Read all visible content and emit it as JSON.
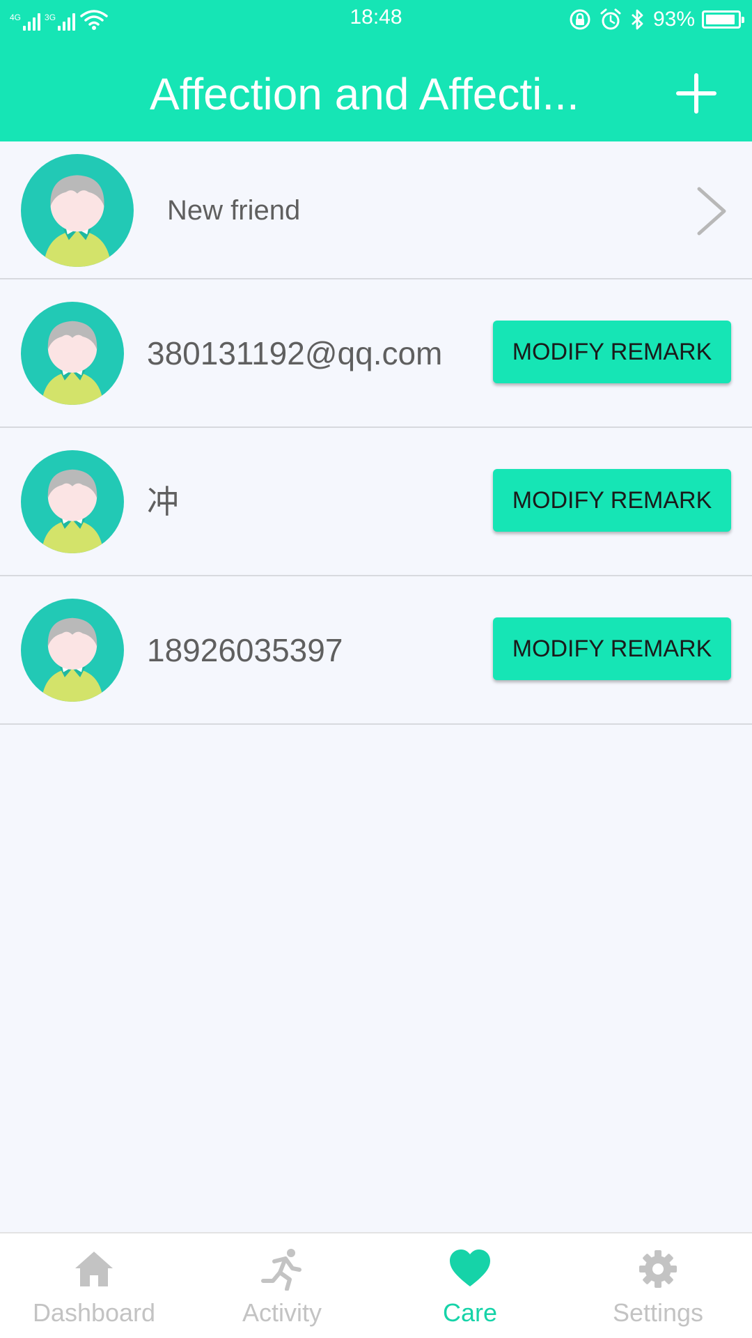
{
  "status_bar": {
    "network_1": "4G",
    "network_2": "3G",
    "time": "18:48",
    "battery": "93%",
    "battery_level": 0.93
  },
  "header": {
    "title": "Affection and Affecti...",
    "add_icon": "plus-icon"
  },
  "new_friend": {
    "label": "New friend",
    "avatar_icon": "avatar-icon",
    "chevron_icon": "chevron-right-icon"
  },
  "contacts": [
    {
      "name": "380131192@qq.com",
      "button_label": "MODIFY REMARK"
    },
    {
      "name": "冲",
      "button_label": "MODIFY REMARK"
    },
    {
      "name": "18926035397",
      "button_label": "MODIFY REMARK"
    }
  ],
  "tabs": [
    {
      "label": "Dashboard",
      "icon": "home-icon",
      "active": false
    },
    {
      "label": "Activity",
      "icon": "running-icon",
      "active": false
    },
    {
      "label": "Care",
      "icon": "heart-icon",
      "active": true
    },
    {
      "label": "Settings",
      "icon": "gear-icon",
      "active": false
    }
  ],
  "colors": {
    "accent": "#16e5b5",
    "background": "#f5f7fd",
    "text": "#5f5f5f",
    "tab_inactive": "#c3c3c3",
    "tab_active": "#16d3a8",
    "avatar_bg": "#22c9b5",
    "avatar_hair": "#b9b9b9",
    "avatar_face": "#fbe4e4",
    "avatar_shirt": "#d3e36a"
  }
}
